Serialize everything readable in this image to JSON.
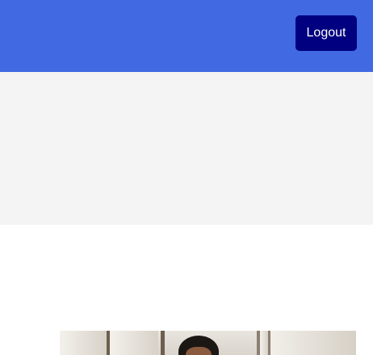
{
  "header": {
    "logout_label": "Logout"
  },
  "colors": {
    "header_background": "#4169e1",
    "logout_button": "#000080",
    "hero_band": "#f4f4f4",
    "page_background": "#ffffff"
  },
  "photo": {
    "subject": "person-photo"
  }
}
